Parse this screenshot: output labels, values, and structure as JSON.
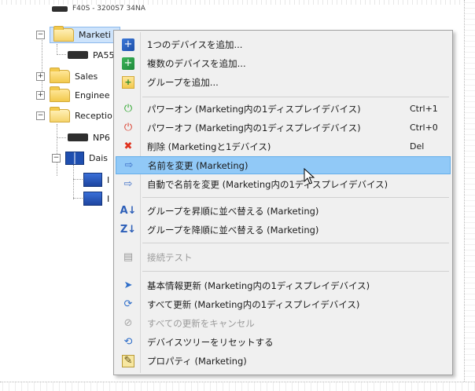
{
  "tree": {
    "top_partial_label": "F40S - 3200S7 34NA",
    "nodes": [
      {
        "label": "Marketi",
        "type": "folder-open",
        "expander": "−",
        "selected": true
      },
      {
        "label": "PA55",
        "type": "device"
      },
      {
        "label": "Sales",
        "type": "folder",
        "expander": "+"
      },
      {
        "label": "Enginee",
        "type": "folder",
        "expander": "+"
      },
      {
        "label": "Receptio",
        "type": "folder-open",
        "expander": "−"
      },
      {
        "label": "NP6",
        "type": "device"
      },
      {
        "label": "Dais",
        "type": "display-group",
        "expander": "−"
      },
      {
        "label": "I",
        "type": "monitor"
      },
      {
        "label": "I",
        "type": "monitor"
      }
    ]
  },
  "context_menu": {
    "items": [
      {
        "icon": "add-device-icon",
        "label": "1つのデバイスを追加...",
        "shortcut": ""
      },
      {
        "icon": "add-devices-icon",
        "label": "複数のデバイスを追加...",
        "shortcut": ""
      },
      {
        "icon": "add-group-icon",
        "label": "グループを追加...",
        "shortcut": ""
      },
      {
        "separator": true
      },
      {
        "icon": "power-on-icon",
        "label": "パワーオン (Marketing内の1ディスプレイデバイス)",
        "shortcut": "Ctrl+1"
      },
      {
        "icon": "power-off-icon",
        "label": "パワーオフ (Marketing内の1ディスプレイデバイス)",
        "shortcut": "Ctrl+0"
      },
      {
        "icon": "delete-icon",
        "label": "削除 (Marketingと1デバイス)",
        "shortcut": "Del"
      },
      {
        "icon": "rename-icon",
        "label": "名前を変更 (Marketing)",
        "shortcut": "",
        "highlighted": true
      },
      {
        "icon": "auto-rename-icon",
        "label": "自動で名前を変更 (Marketing内の1ディスプレイデバイス)",
        "shortcut": ""
      },
      {
        "separator": true
      },
      {
        "icon": "sort-ascending-icon",
        "label": "グループを昇順に並べ替える (Marketing)",
        "shortcut": ""
      },
      {
        "icon": "sort-descending-icon",
        "label": "グループを降順に並べ替える (Marketing)",
        "shortcut": ""
      },
      {
        "separator": true
      },
      {
        "icon": "connection-test-icon",
        "label": "接続テスト",
        "shortcut": "",
        "disabled": true
      },
      {
        "separator": true
      },
      {
        "icon": "refresh-basic-icon",
        "label": "基本情報更新 (Marketing内の1ディスプレイデバイス)",
        "shortcut": ""
      },
      {
        "icon": "refresh-all-icon",
        "label": "すべて更新 (Marketing内の1ディスプレイデバイス)",
        "shortcut": ""
      },
      {
        "icon": "cancel-refresh-icon",
        "label": "すべての更新をキャンセル",
        "shortcut": "",
        "disabled": true
      },
      {
        "icon": "reset-tree-icon",
        "label": "デバイスツリーをリセットする",
        "shortcut": ""
      },
      {
        "icon": "properties-icon",
        "label": "プロパティ (Marketing)",
        "shortcut": ""
      }
    ]
  },
  "colors": {
    "menu_bg": "#f0f0f0",
    "highlight": "#91c9f7",
    "selected_tree": "#cde3fb"
  }
}
